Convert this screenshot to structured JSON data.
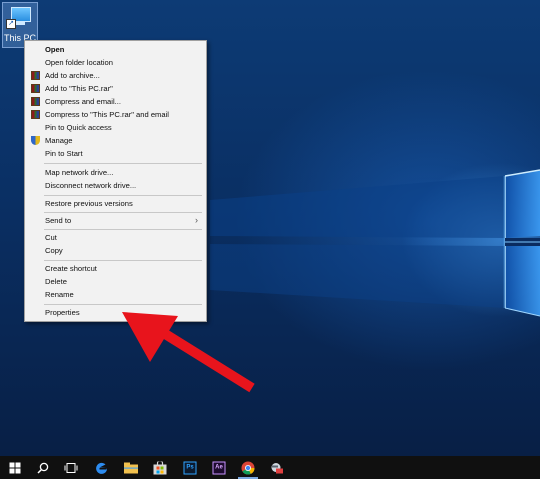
{
  "desktop": {
    "icon_label": "This PC"
  },
  "context_menu": {
    "items": [
      {
        "label": "Open",
        "bold": true,
        "icon": ""
      },
      {
        "label": "Open folder location",
        "icon": ""
      },
      {
        "label": "Add to archive...",
        "icon": "winrar-icon"
      },
      {
        "label": "Add to \"This PC.rar\"",
        "icon": "winrar-icon"
      },
      {
        "label": "Compress and email...",
        "icon": "winrar-icon"
      },
      {
        "label": "Compress to \"This PC.rar\" and email",
        "icon": "winrar-icon"
      },
      {
        "label": "Pin to Quick access",
        "icon": ""
      },
      {
        "label": "Manage",
        "icon": "admin-shield-icon"
      },
      {
        "label": "Pin to Start",
        "icon": ""
      },
      {
        "label": "Map network drive...",
        "icon": ""
      },
      {
        "label": "Disconnect network drive...",
        "icon": ""
      },
      {
        "label": "Restore previous versions",
        "icon": ""
      },
      {
        "label": "Send to",
        "icon": "",
        "submenu": true
      },
      {
        "label": "Cut",
        "icon": ""
      },
      {
        "label": "Copy",
        "icon": ""
      },
      {
        "label": "Create shortcut",
        "icon": ""
      },
      {
        "label": "Delete",
        "icon": ""
      },
      {
        "label": "Rename",
        "icon": ""
      },
      {
        "label": "Properties",
        "icon": ""
      }
    ]
  },
  "annotation": {
    "arrow_color": "#e8141c"
  },
  "taskbar": {
    "items": [
      "start-icon",
      "search-icon",
      "task-view-icon",
      "edge-icon",
      "file-explorer-icon",
      "store-icon",
      "photoshop-icon",
      "after-effects-icon",
      "chrome-icon",
      "app-icon"
    ],
    "ps_label": "Ps",
    "ae_label": "Ae"
  }
}
